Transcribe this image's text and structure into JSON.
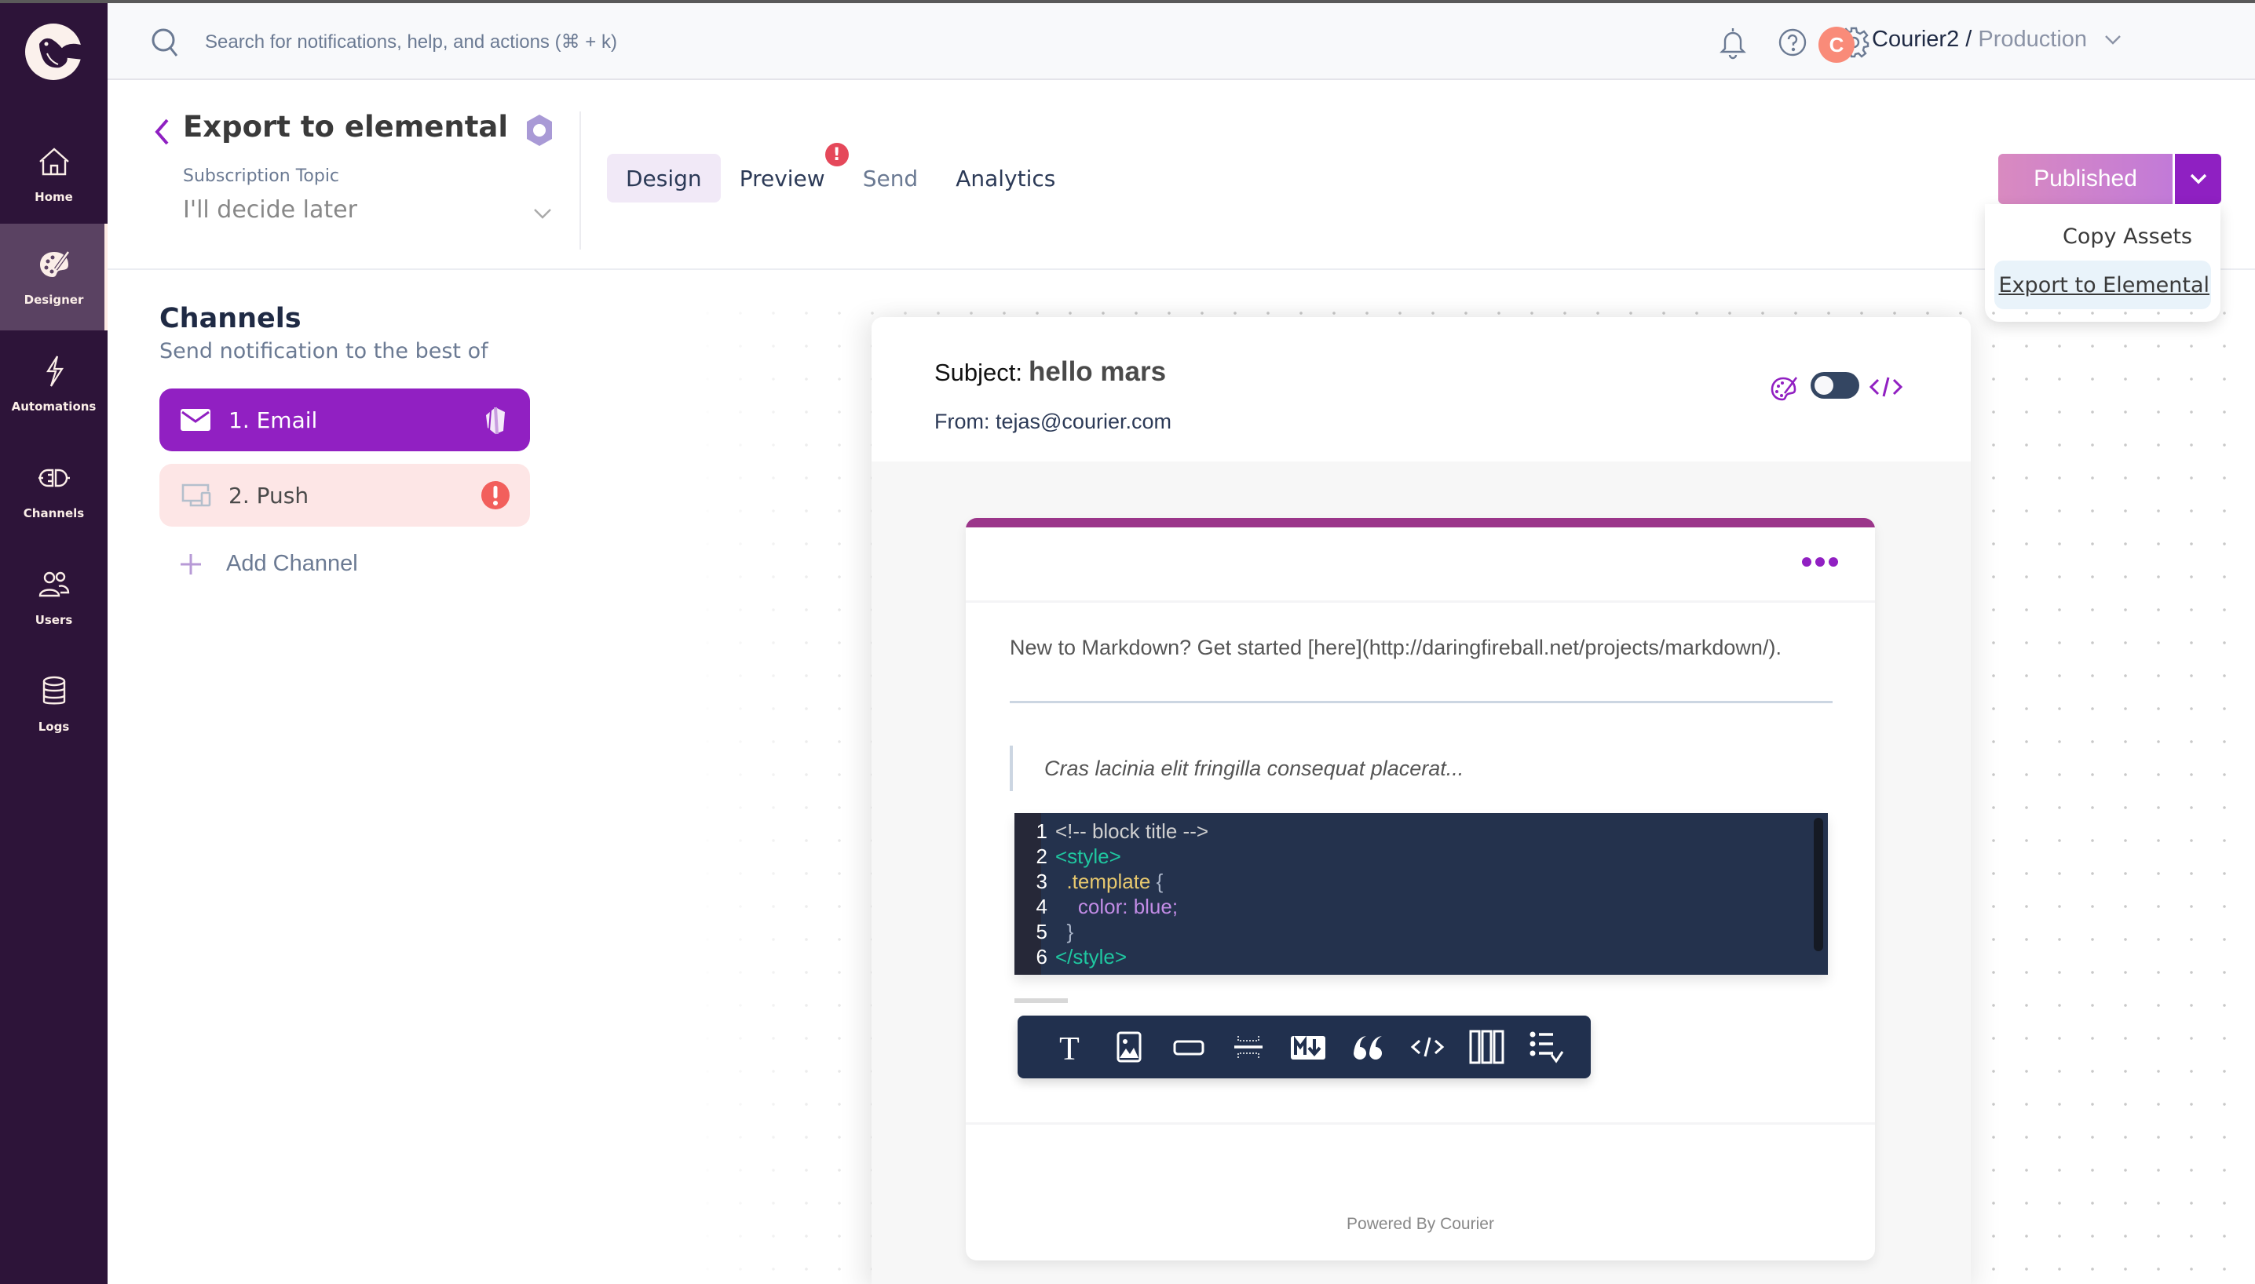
{
  "nav": {
    "logo": "courier-bird-logo",
    "items": [
      {
        "label": "Home",
        "icon": "home-icon",
        "active": false
      },
      {
        "label": "Designer",
        "icon": "palette-icon",
        "active": true
      },
      {
        "label": "Automations",
        "icon": "lightning-icon",
        "active": false
      },
      {
        "label": "Channels",
        "icon": "plug-icon",
        "active": false
      },
      {
        "label": "Users",
        "icon": "users-icon",
        "active": false
      },
      {
        "label": "Logs",
        "icon": "database-icon",
        "active": false
      }
    ]
  },
  "topbar": {
    "search_placeholder": "Search for notifications, help, and actions (⌘ + k)",
    "icons": [
      "bell-icon",
      "help-icon",
      "gear-icon"
    ],
    "avatar_initial": "C",
    "workspace_org": "Courier2",
    "workspace_sep": " / ",
    "workspace_env": "Production"
  },
  "template": {
    "title": "Export to elemental",
    "subscription_label": "Subscription Topic",
    "subscription_value": "I'll decide later"
  },
  "tabs": [
    {
      "label": "Design",
      "active": true
    },
    {
      "label": "Preview",
      "alert": "!"
    },
    {
      "label": "Send",
      "muted": true
    },
    {
      "label": "Analytics"
    }
  ],
  "publish": {
    "label": "Published",
    "menu": [
      {
        "label": "Copy Assets"
      },
      {
        "label": "Export to Elemental",
        "hovered": true
      }
    ]
  },
  "channels": {
    "title": "Channels",
    "subtitle": "Send notification to the best of",
    "items": [
      {
        "label": "1.  Email",
        "icon": "envelope-icon",
        "selected": true,
        "status": "provider-logo-icon"
      },
      {
        "label": "2.  Push",
        "icon": "devices-icon",
        "selected": false,
        "status": "error-icon"
      }
    ],
    "add_label": "Add Channel"
  },
  "email": {
    "subject_label": "Subject:",
    "subject_value": "hello mars",
    "from": "From: tejas@courier.com",
    "brand_color": "#9b368a",
    "markdown_text": "New to Markdown? Get started [here](http://daringfireball.net/projects/markdown/).",
    "quote_text": "Cras lacinia elit fringilla consequat placerat...",
    "code_lines": [
      {
        "n": "1",
        "parts": [
          {
            "t": "<!-- block title -->",
            "c": "c-comment"
          }
        ]
      },
      {
        "n": "2",
        "parts": [
          {
            "t": "<style>",
            "c": "c-tag"
          }
        ]
      },
      {
        "n": "3",
        "parts": [
          {
            "t": "  .template ",
            "c": "c-sel"
          },
          {
            "t": "{",
            "c": "c-brace"
          }
        ]
      },
      {
        "n": "4",
        "parts": [
          {
            "t": "    color: blue;",
            "c": "c-prop"
          }
        ]
      },
      {
        "n": "5",
        "parts": [
          {
            "t": "  }",
            "c": "c-brace"
          }
        ]
      },
      {
        "n": "6",
        "parts": [
          {
            "t": "</style>",
            "c": "c-tag"
          }
        ]
      }
    ],
    "toolbar": [
      "text-icon",
      "image-icon",
      "button-icon",
      "divider-icon",
      "markdown-icon",
      "quote-icon",
      "code-icon",
      "columns-icon",
      "list-icon"
    ],
    "footer": "Powered By Courier"
  }
}
